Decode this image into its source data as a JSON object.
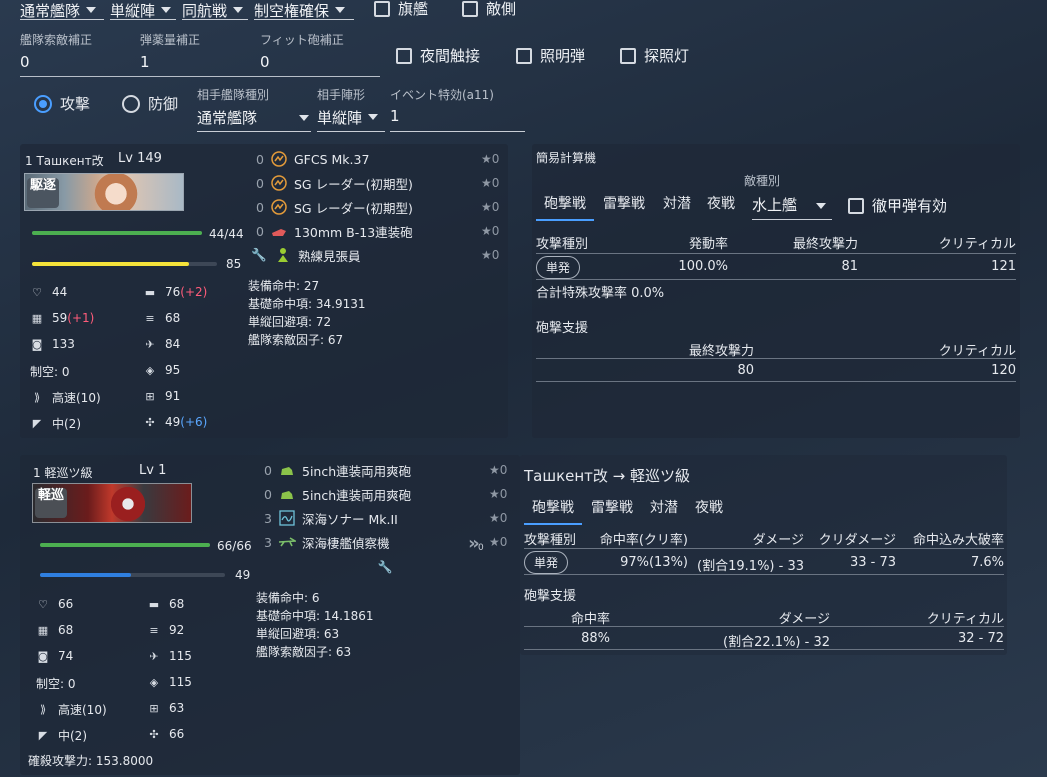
{
  "top": {
    "fleet_type": "通常艦隊",
    "formation": "単縦陣",
    "battle": "同航戦",
    "air": "制空権確保",
    "flagship_label": "旗艦",
    "enemy_side_label": "敵側",
    "los_label": "艦隊索敵補正",
    "los_value": "0",
    "ammo_label": "弾薬量補正",
    "ammo_value": "1",
    "fit_label": "フィット砲補正",
    "fit_value": "0",
    "night_contact": "夜間触接",
    "star_shell": "照明弾",
    "searchlight": "探照灯",
    "attack": "攻撃",
    "defense": "防御",
    "enemy_fleet_label": "相手艦隊種別",
    "enemy_fleet": "通常艦隊",
    "enemy_form_label": "相手陣形",
    "enemy_form": "単縦陣",
    "event_label": "イベント特効(a11)",
    "event_value": "1"
  },
  "ship1": {
    "name": "1 Ташкент改",
    "level": "Lv 149",
    "banner": "駆逐",
    "hp": "44/44",
    "hp_frac": 1.0,
    "morale": "85",
    "morale_frac": 0.85,
    "stats": {
      "hp": "44",
      "fp": "76",
      "fp_bonus": "(+2)",
      "armor": "59",
      "armor_bonus": "(+1)",
      "tp": "68",
      "aa": "133",
      "asw": "84",
      "air": "制空: 0",
      "eva": "95",
      "speed": "高速(10)",
      "los": "91",
      "range": "中(2)",
      "luck": "49",
      "luck_bonus": "(+6)"
    },
    "equip": [
      {
        "n": "0",
        "name": "GFCS Mk.37",
        "star": "★0"
      },
      {
        "n": "0",
        "name": "SG レーダー(初期型)",
        "star": "★0"
      },
      {
        "n": "0",
        "name": "SG レーダー(初期型)",
        "star": "★0"
      },
      {
        "n": "0",
        "name": "130mm B-13連装砲",
        "star": "★0"
      },
      {
        "n": "",
        "name": "熟練見張員",
        "star": "★0"
      }
    ],
    "info": [
      "装備命中: 27",
      "基礎命中項: 34.9131",
      "単縦回避項: 72",
      "艦隊索敵因子: 67"
    ]
  },
  "calc": {
    "title": "簡易計算機",
    "tabs": [
      "砲撃戦",
      "雷撃戦",
      "対潜",
      "夜戦"
    ],
    "enemy_type_label": "敵種別",
    "enemy_type": "水上艦",
    "ap_label": "徹甲弾有効",
    "head": [
      "攻撃種別",
      "発動率",
      "最終攻撃力",
      "クリティカル"
    ],
    "row": [
      "単発",
      "100.0%",
      "81",
      "121"
    ],
    "total": "合計特殊攻撃率 0.0%",
    "support_title": "砲撃支援",
    "support_head": [
      "最終攻撃力",
      "クリティカル"
    ],
    "support_row": [
      "80",
      "120"
    ]
  },
  "ship2": {
    "name": "1 軽巡ツ級",
    "level": "Lv 1",
    "banner": "軽巡",
    "hp": "66/66",
    "hp_frac": 1.0,
    "morale": "49",
    "morale_frac": 0.49,
    "stats": {
      "hp": "66",
      "fp": "68",
      "armor": "68",
      "tp": "92",
      "aa": "74",
      "asw": "115",
      "air": "制空: 0",
      "eva": "115",
      "speed": "高速(10)",
      "los": "63",
      "range": "中(2)",
      "luck": "66"
    },
    "equip": [
      {
        "n": "0",
        "name": "5inch連装両用爽砲",
        "star": "★0"
      },
      {
        "n": "0",
        "name": "5inch連装両用爽砲",
        "star": "★0"
      },
      {
        "n": "3",
        "name": "深海ソナー Mk.II",
        "star": "★0"
      },
      {
        "n": "3",
        "name": "深海棲艦偵察機",
        "star": "★0"
      }
    ],
    "exp_small": "0",
    "info": [
      "装備命中: 6",
      "基礎命中項: 14.1861",
      "単縦回避項: 63",
      "艦隊索敵因子: 63"
    ],
    "kill_power": "確殺攻撃力: 153.8000"
  },
  "enemy_calc": {
    "title": "Ташкент改 → 軽巡ツ級",
    "tabs": [
      "砲撃戦",
      "雷撃戦",
      "対潜",
      "夜戦"
    ],
    "head": [
      "攻撃種別",
      "命中率(クリ率)",
      "ダメージ",
      "クリダメージ",
      "命中込み大破率"
    ],
    "row": [
      "単発",
      "97%(13%)",
      "(割合19.1%) - 33",
      "33 - 73",
      "7.6%"
    ],
    "support_title": "砲撃支援",
    "support_head": [
      "命中率",
      "ダメージ",
      "クリティカル"
    ],
    "support_row": [
      "88%",
      "(割合22.1%) - 32",
      "32 - 72"
    ]
  }
}
